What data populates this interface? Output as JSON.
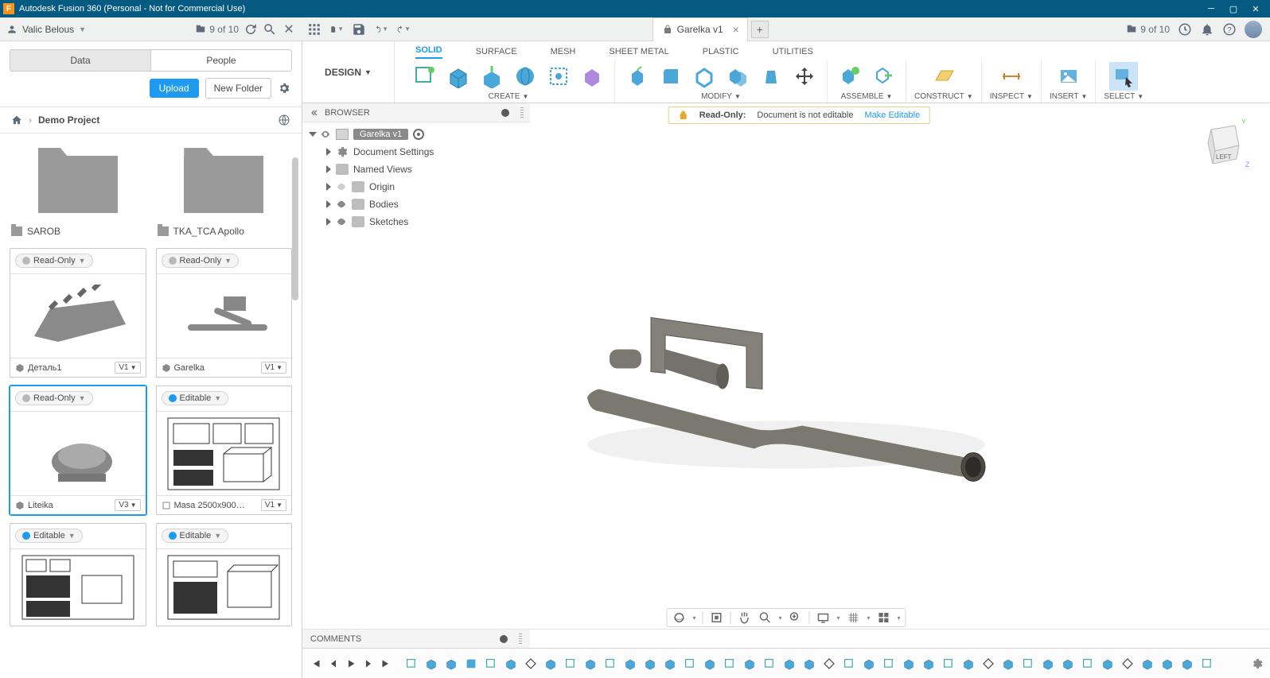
{
  "titlebar": {
    "text": "Autodesk Fusion 360 (Personal - Not for Commercial Use)"
  },
  "header": {
    "username": "Valic Belous",
    "jobcount_left": "9 of 10",
    "jobcount_right": "9 of 10"
  },
  "doc_tab": {
    "title": "Garelka v1"
  },
  "left_tabs": {
    "data": "Data",
    "people": "People"
  },
  "left_buttons": {
    "upload": "Upload",
    "new_folder": "New Folder"
  },
  "breadcrumb": {
    "project": "Demo Project"
  },
  "folders": [
    {
      "name": "SAROB"
    },
    {
      "name": "TKA_TCA Apollo"
    }
  ],
  "thumbs": [
    {
      "badge": "Read-Only",
      "editable": false,
      "name": "Деталь1",
      "ver": "V1",
      "selected": false
    },
    {
      "badge": "Read-Only",
      "editable": false,
      "name": "Garelka",
      "ver": "V1",
      "selected": false
    },
    {
      "badge": "Read-Only",
      "editable": false,
      "name": "Liteika",
      "ver": "V3",
      "selected": true
    },
    {
      "badge": "Editable",
      "editable": true,
      "name": "Masa 2500x900…",
      "ver": "V1",
      "selected": false
    },
    {
      "badge": "Editable",
      "editable": true,
      "name": "",
      "ver": "",
      "selected": false
    },
    {
      "badge": "Editable",
      "editable": true,
      "name": "",
      "ver": "",
      "selected": false
    }
  ],
  "design_label": "DESIGN",
  "ribbon_tabs": [
    "SOLID",
    "SURFACE",
    "MESH",
    "SHEET METAL",
    "PLASTIC",
    "UTILITIES"
  ],
  "ribbon_groups": {
    "create": "CREATE",
    "modify": "MODIFY",
    "assemble": "ASSEMBLE",
    "construct": "CONSTRUCT",
    "inspect": "INSPECT",
    "insert": "INSERT",
    "select": "SELECT"
  },
  "browser": {
    "title": "BROWSER",
    "root": "Garelka v1",
    "items": [
      "Document Settings",
      "Named Views",
      "Origin",
      "Bodies",
      "Sketches"
    ]
  },
  "readonly_bar": {
    "label": "Read-Only:",
    "msg": "Document is not editable",
    "link": "Make Editable"
  },
  "comments": {
    "title": "COMMENTS"
  },
  "viewcube": {
    "face": "LEFT"
  }
}
